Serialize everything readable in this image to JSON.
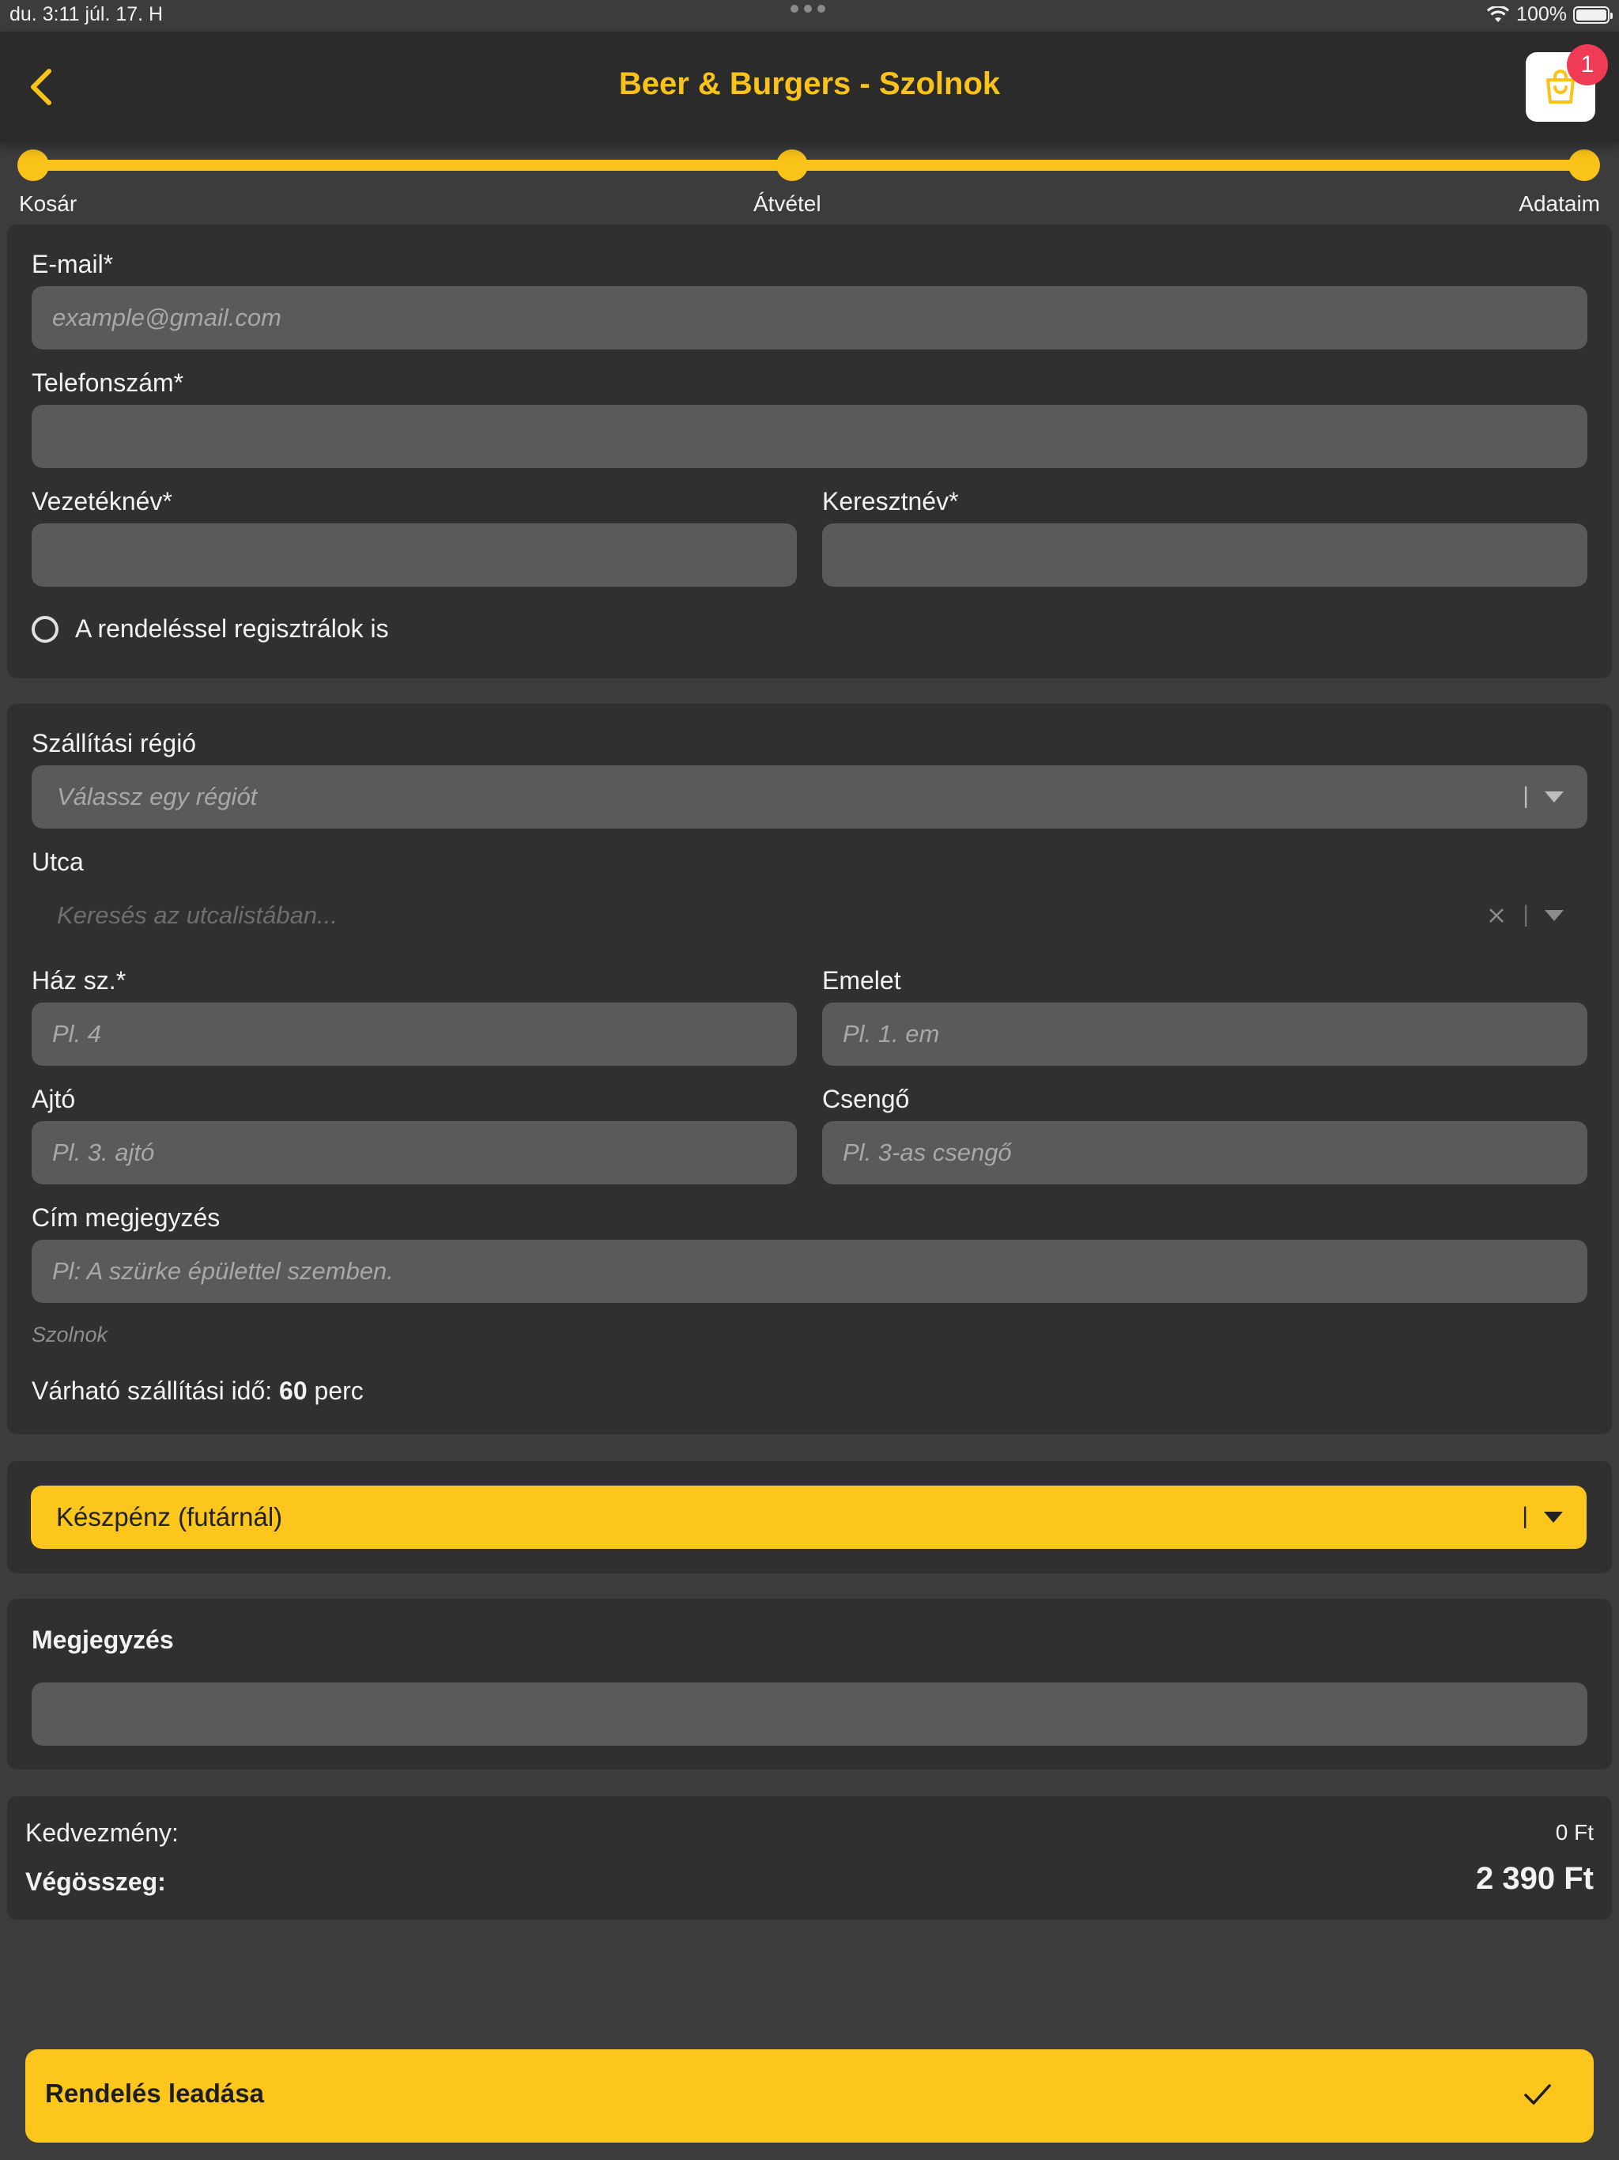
{
  "status_bar": {
    "time": "du. 3:11   júl. 17. H",
    "battery": "100%"
  },
  "header": {
    "title": "Beer & Burgers - Szolnok",
    "cart_badge": "1"
  },
  "progress_steps": [
    "Kosár",
    "Átvétel",
    "Adataim"
  ],
  "personal": {
    "email_label": "E-mail*",
    "email_placeholder": "example@gmail.com",
    "phone_label": "Telefonszám*",
    "lastname_label": "Vezetéknév*",
    "firstname_label": "Keresztnév*",
    "register_label": "A rendeléssel regisztrálok is"
  },
  "address": {
    "region_label": "Szállítási régió",
    "region_placeholder": "Válassz egy régiót",
    "street_label": "Utca",
    "street_placeholder": "Keresés az utcalistában...",
    "house_label": "Ház sz.*",
    "house_placeholder": "Pl. 4",
    "floor_label": "Emelet",
    "floor_placeholder": "Pl. 1. em",
    "door_label": "Ajtó",
    "door_placeholder": "Pl. 3. ajtó",
    "bell_label": "Csengő",
    "bell_placeholder": "Pl. 3-as csengő",
    "note_label": "Cím megjegyzés",
    "note_placeholder": "Pl: A szürke épülettel szemben.",
    "city": "Szolnok",
    "delivery_prefix": "Várható szállítási idő:",
    "delivery_minutes": "60",
    "delivery_unit": "perc"
  },
  "payment": {
    "selected": "Készpénz (futárnál)",
    "separator": "|"
  },
  "comment": {
    "label": "Megjegyzés"
  },
  "summary": {
    "discount_label": "Kedvezmény:",
    "discount_value": "0 Ft",
    "total_label": "Végösszeg:",
    "total_value": "2 390 Ft"
  },
  "submit": {
    "label": "Rendelés leadása"
  },
  "colors": {
    "accent": "#fcc61d",
    "badge": "#ef3b55",
    "background": "#3c3c3c",
    "card": "#303030",
    "input": "#5a5a5a"
  }
}
